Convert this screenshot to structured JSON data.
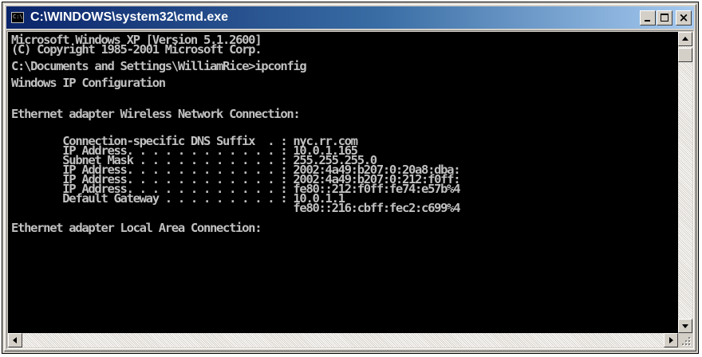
{
  "window": {
    "title": "C:\\WINDOWS\\system32\\cmd.exe",
    "icon": "cmd-icon",
    "icon_label": "C:\\",
    "buttons": {
      "minimize_icon": "minimize-icon",
      "maximize_icon": "maximize-icon",
      "close_icon": "close-icon",
      "close_glyph": "×"
    }
  },
  "console": {
    "foreground": "#c0c0c0",
    "background": "#000000",
    "lines": [
      "Microsoft Windows XP [Version 5.1.2600]",
      "(C) Copyright 1985-2001 Microsoft Corp.",
      "",
      "C:\\Documents and Settings\\WilliamRice>ipconfig",
      "",
      "Windows IP Configuration",
      "",
      "",
      "Ethernet adapter Wireless Network Connection:",
      "",
      "        Connection-specific DNS Suffix  . : nyc.rr.com",
      "        IP Address. . . . . . . . . . . . : 10.0.1.165",
      "        Subnet Mask . . . . . . . . . . . : 255.255.255.0",
      "        IP Address. . . . . . . . . . . . : 2002:4a49:b207:0:20a8:dba:",
      "        IP Address. . . . . . . . . . . . : 2002:4a49:b207:0:212:f0ff:",
      "        IP Address. . . . . . . . . . . . : fe80::212:f0ff:fe74:e57b%4",
      "        Default Gateway . . . . . . . . . : 10.0.1.1",
      "                                            fe80::216:cbff:fec2:c699%4",
      "",
      "Ethernet adapter Local Area Connection:"
    ]
  },
  "scrollbars": {
    "up_icon": "scroll-up-arrow-icon",
    "down_icon": "scroll-down-arrow-icon",
    "left_icon": "scroll-left-arrow-icon",
    "right_icon": "scroll-right-arrow-icon"
  }
}
